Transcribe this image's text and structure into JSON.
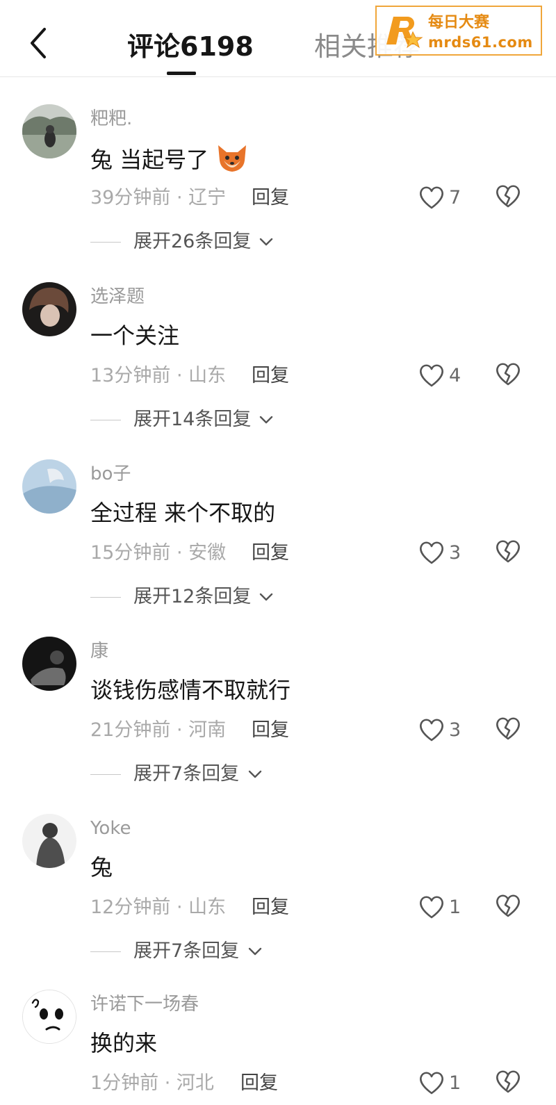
{
  "header": {
    "back_icon": "chevron-left-icon",
    "tabs": [
      {
        "label": "评论6198",
        "active": true
      },
      {
        "label": "相关推荐",
        "active": false
      }
    ]
  },
  "watermark": {
    "cn": "每日大赛",
    "en": "mrds61.com",
    "color": "#e58a12"
  },
  "comments": [
    {
      "username": "粑粑.",
      "content": "兔 当起号了",
      "emoji": "fox-emoji",
      "time": "39分钟前 · 辽宁",
      "reply_label": "回复",
      "likes": "7",
      "expand_label": "展开26条回复"
    },
    {
      "username": "选泽题",
      "content": "一个关注",
      "time": "13分钟前 · 山东",
      "reply_label": "回复",
      "likes": "4",
      "expand_label": "展开14条回复"
    },
    {
      "username": "bo子",
      "content": "全过程 来个不取的",
      "time": "15分钟前 · 安徽",
      "reply_label": "回复",
      "likes": "3",
      "expand_label": "展开12条回复"
    },
    {
      "username": "康",
      "content": "谈钱伤感情不取就行",
      "time": "21分钟前 · 河南",
      "reply_label": "回复",
      "likes": "3",
      "expand_label": "展开7条回复"
    },
    {
      "username": "Yoke",
      "content": "兔",
      "time": "12分钟前 · 山东",
      "reply_label": "回复",
      "likes": "1",
      "expand_label": "展开7条回复"
    },
    {
      "username": "许诺下一场春",
      "content": "换的来",
      "time": "1分钟前 · 河北",
      "reply_label": "回复",
      "likes": "1"
    }
  ]
}
